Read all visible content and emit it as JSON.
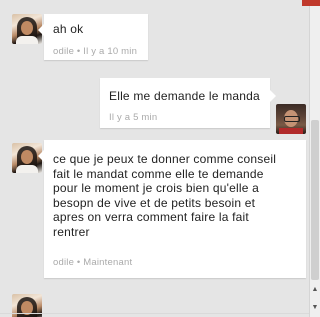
{
  "messages": [
    {
      "sender": "odile",
      "text": "ah ok",
      "meta": "odile • Il y a 10 min",
      "avatar_icon": "user-photo-icon"
    },
    {
      "sender": "me",
      "text": "Elle me demande le manda",
      "meta": "Il y a 5 min",
      "avatar_icon": "user-photo-icon"
    },
    {
      "sender": "odile",
      "text": "ce que je peux te donner comme conseil\nfait le mandat comme elle te demande\n pour le moment je crois bien qu'elle a\nbesopn de vive et de petits besoin et\napres on verra  comment faire  la fait\nrentrer",
      "meta": "odile • Maintenant",
      "avatar_icon": "user-photo-icon"
    }
  ],
  "colors": {
    "background": "#e5e5e5",
    "bubble": "#ffffff",
    "meta_text": "#aaaaaa",
    "badge": "#c0392b"
  }
}
